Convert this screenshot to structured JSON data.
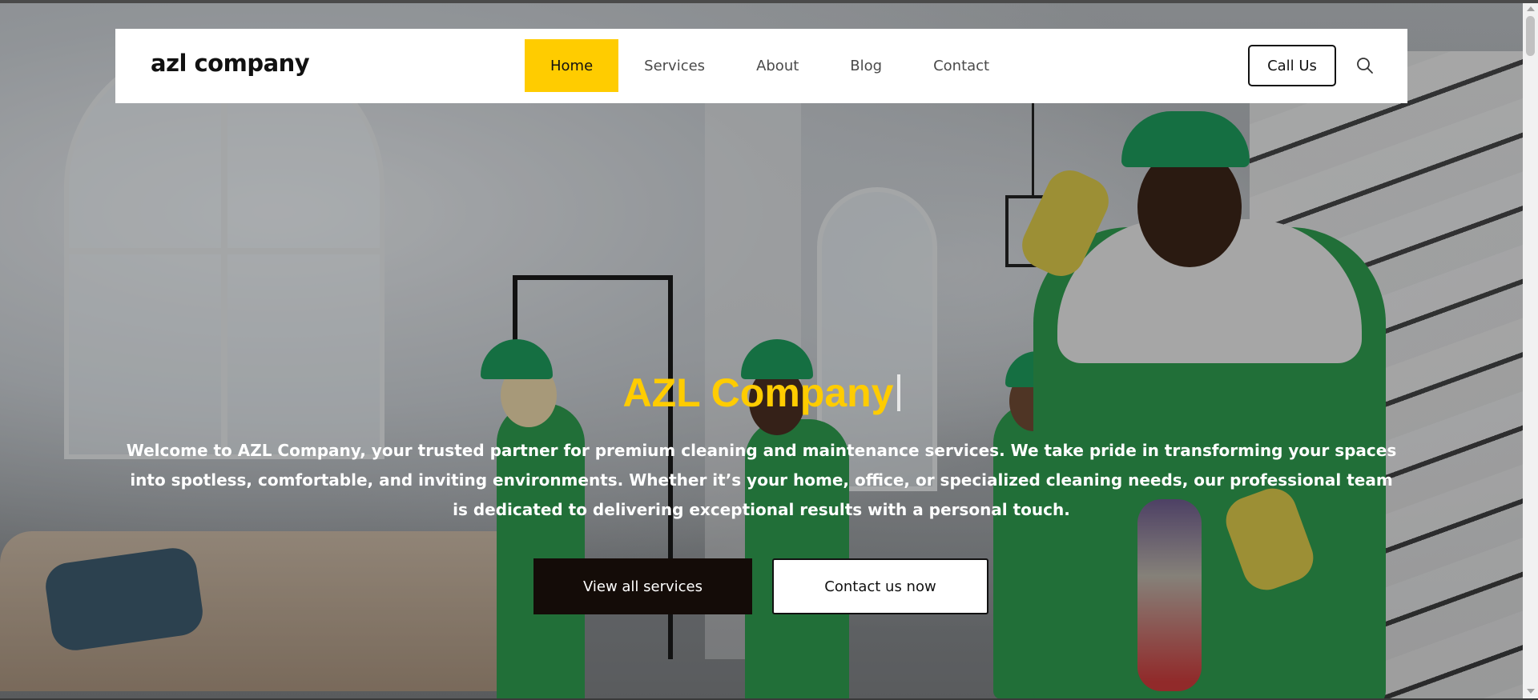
{
  "header": {
    "logo": "azl company",
    "nav": [
      {
        "label": "Home",
        "active": true
      },
      {
        "label": "Services",
        "active": false
      },
      {
        "label": "About",
        "active": false
      },
      {
        "label": "Blog",
        "active": false
      },
      {
        "label": "Contact",
        "active": false
      }
    ],
    "call_label": "Call Us",
    "search_icon": "search-icon"
  },
  "hero": {
    "title": "AZL Company",
    "description": "Welcome to AZL Company, your trusted partner for premium cleaning and maintenance services. We take pride in transforming your spaces into spotless, comfortable, and inviting environments. Whether it’s your home, office, or specialized cleaning needs, our professional team is dedicated to delivering exceptional results with a personal touch.",
    "primary_button": "View all services",
    "secondary_button": "Contact us now"
  },
  "colors": {
    "accent": "#ffcc00",
    "dark_button": "#140c08",
    "header_bg": "#ffffff"
  }
}
